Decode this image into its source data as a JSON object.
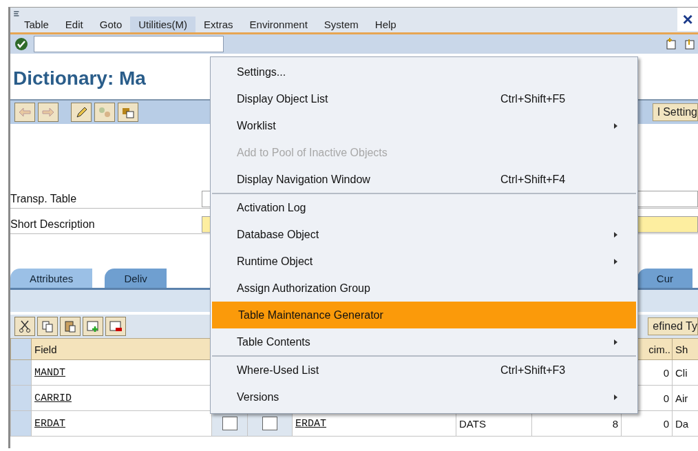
{
  "menu_bar": {
    "items": [
      {
        "label": "Table",
        "selected": false
      },
      {
        "label": "Edit",
        "selected": false
      },
      {
        "label": "Goto",
        "selected": false
      },
      {
        "label": "Utilities(M)",
        "selected": true
      },
      {
        "label": "Extras",
        "selected": false
      },
      {
        "label": "Environment",
        "selected": false
      },
      {
        "label": "System",
        "selected": false
      },
      {
        "label": "Help",
        "selected": false
      }
    ],
    "close": "×"
  },
  "title": "Dictionary: Ma",
  "app_toolbar": {
    "right_button": "l Setting"
  },
  "fields": [
    {
      "label": "Transp. Table",
      "kind": "plain"
    },
    {
      "label": "Short Description",
      "kind": "required"
    }
  ],
  "tabs": [
    {
      "label": "Attributes",
      "selected": true
    },
    {
      "label": "Deliv",
      "selected": false
    },
    {
      "label": "Cur",
      "selected": false
    }
  ],
  "table_toolbar": {
    "right_button": "efined Ty"
  },
  "table": {
    "columns": [
      {
        "label": "Field"
      },
      {
        "label": "cim.."
      },
      {
        "label": "Sh"
      }
    ],
    "rows": [
      {
        "field": "MANDT",
        "decimals": "0",
        "short_description": "Cli"
      },
      {
        "field": "CARRID",
        "decimals": "0",
        "short_description": "Air"
      },
      {
        "field": "ERDAT",
        "key": false,
        "initial": false,
        "data_element": "ERDAT",
        "data_type": "DATS",
        "length": "8",
        "decimals": "0",
        "short_description": "Da"
      }
    ]
  },
  "dropdown_menu": {
    "items": [
      {
        "kind": "item",
        "label": "Settings...",
        "disabled": false,
        "selected": false,
        "submenu": false
      },
      {
        "kind": "item",
        "label": "Display Object List",
        "shortcut": "Ctrl+Shift+F5",
        "disabled": false,
        "selected": false,
        "submenu": false
      },
      {
        "kind": "item",
        "label": "Worklist",
        "disabled": false,
        "selected": false,
        "submenu": true
      },
      {
        "kind": "item",
        "label": "Add to Pool of Inactive Objects",
        "disabled": true,
        "selected": false,
        "submenu": false
      },
      {
        "kind": "item",
        "label": "Display Navigation Window",
        "shortcut": "Ctrl+Shift+F4",
        "disabled": false,
        "selected": false,
        "submenu": false
      },
      {
        "kind": "separator"
      },
      {
        "kind": "item",
        "label": "Activation Log",
        "disabled": false,
        "selected": false,
        "submenu": false
      },
      {
        "kind": "item",
        "label": "Database Object",
        "disabled": false,
        "selected": false,
        "submenu": true
      },
      {
        "kind": "item",
        "label": "Runtime Object",
        "disabled": false,
        "selected": false,
        "submenu": true
      },
      {
        "kind": "item",
        "label": "Assign Authorization Group",
        "disabled": false,
        "selected": false,
        "submenu": false
      },
      {
        "kind": "item",
        "label": "Table Maintenance Generator",
        "disabled": false,
        "selected": true,
        "submenu": false
      },
      {
        "kind": "item",
        "label": "Table Contents",
        "disabled": false,
        "selected": false,
        "submenu": true
      },
      {
        "kind": "separator"
      },
      {
        "kind": "item",
        "label": "Where-Used List",
        "shortcut": "Ctrl+Shift+F3",
        "disabled": false,
        "selected": false,
        "submenu": false
      },
      {
        "kind": "item",
        "label": "Versions",
        "disabled": false,
        "selected": false,
        "submenu": true
      }
    ]
  }
}
